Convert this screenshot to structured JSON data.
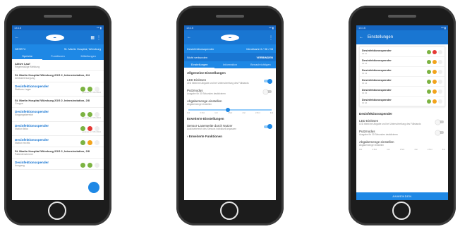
{
  "phone1": {
    "status": {
      "left": "13:15",
      "right": "⁶ᴳ ▮"
    },
    "subbar": {
      "left": "NE3R74",
      "right": "St. Martin Hospital, Würzburg"
    },
    "tabs": [
      "Sprüche",
      "Funktionen",
      "Mitteilungen"
    ],
    "items": [
      {
        "title": "Aktive Lauf",
        "sub": "Regelmäßige Meldung",
        "time": ""
      },
      {
        "title": "St. Martin Hospital Würzburg 2OG 2, Intensivstation, 2/4",
        "sub": "Zentralversorgung",
        "time": ""
      },
      {
        "title": "Desinfektionsspender",
        "sub": "Stations-Lager",
        "time": "gelesen 17.06.2021"
      },
      {
        "title": "St. Martin Hospital Würzburg 2OG 2, Intensivstation, 2/8",
        "sub": "Gruppe",
        "time": ""
      },
      {
        "title": "Desinfektionsspender",
        "sub": "Eingangsbereich",
        "time": "gelesen 17.06.2021"
      },
      {
        "title": "Desinfektionsspender",
        "sub": "Station links",
        "time": "gelesen 17.06.2021"
      },
      {
        "title": "Desinfektionsspender",
        "sub": "Station rechts",
        "time": "gelesen 17.06.2021"
      },
      {
        "title": "St. Martin Hospital Würzburg 2OG 2, Intensivstation, 2/8",
        "sub": "Patientenzimmer",
        "time": ""
      },
      {
        "title": "Desinfektionsspender",
        "sub": "Ausgang",
        "time": ""
      }
    ]
  },
  "phone2": {
    "status": {
      "left": "13:15",
      "right": "⁶ᴳ ▮"
    },
    "subbar": {
      "left": "Desinfektionsspender",
      "right": "Menükarte 6 / 96 / 08"
    },
    "subbar2": {
      "left": "Nicht verbunden",
      "right": "VERBINDEN"
    },
    "tabs": [
      "Einstellungen",
      "Information",
      "Benachrichtigen"
    ],
    "section1": "Allgemeine Einstellungen",
    "led": {
      "title": "LED Einlösen",
      "desc": "LED blinkt bei Abgabe und bei Unterschreitung des Füllstands"
    },
    "putzmodus": {
      "title": "Putzmodus",
      "desc": "Ausgabe für 30 Sekunden deaktivieren"
    },
    "abgabe": {
      "title": "Abgabemenge einstellen",
      "desc": "Abgabemenge einstellen"
    },
    "ticks": [
      "0ml",
      "0.5ml",
      "1ml",
      "1.5ml",
      "2ml",
      "2.5ml",
      "3ml"
    ],
    "section2": "Erweiterte Einstellungen",
    "sensor": {
      "title": "Sensor-Laserweite durch Nutzer",
      "desc": "Auslösebereich des Sensors individuell anpassen"
    },
    "erweitert": "Erweiterte Funktionen"
  },
  "phone3": {
    "status": {
      "left": "13:15",
      "right": "⁶ᴳ ▮"
    },
    "title": "Einstellungen",
    "items": [
      {
        "title": "Desinfektionsspender",
        "sub": "ID 11"
      },
      {
        "title": "Desinfektionsspender",
        "sub": "ID 12"
      },
      {
        "title": "Desinfektionsspender",
        "sub": "ID 13"
      },
      {
        "title": "Desinfektionsspender",
        "sub": "ID 14"
      },
      {
        "title": "Desinfektionsspender",
        "sub": "ID 15"
      },
      {
        "title": "Desinfektionsspender",
        "sub": "ID 16"
      }
    ],
    "section": "Desinfektionsspender",
    "led": {
      "title": "LED Einlösen",
      "desc": "LED blinkt bei Abgabe und bei Unterschreitung des Füllstands"
    },
    "putzmodus": {
      "title": "Putzmodus",
      "desc": "Ausgabe für 30 Sekunden deaktivieren"
    },
    "abgabe": {
      "title": "Abgabemenge einstellen",
      "desc": "Abgabemenge einstellen"
    },
    "ticks": [
      "0ml",
      "0.5ml",
      "1ml",
      "1.5ml",
      "2ml",
      "2.5ml",
      "3ml"
    ],
    "apply": "ANWENDEN"
  }
}
